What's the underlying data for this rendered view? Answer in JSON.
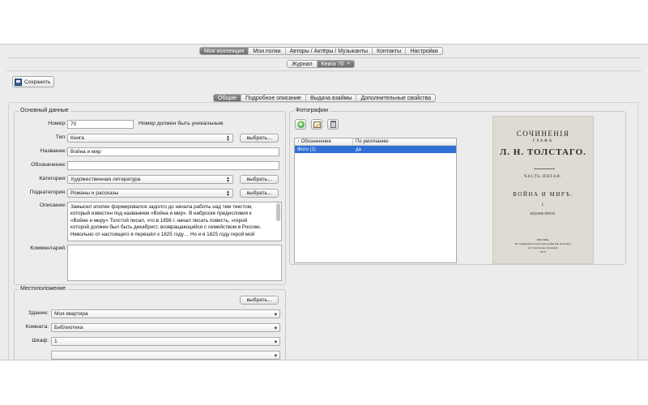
{
  "main_tabs": [
    "Моя коллекция",
    "Мои полки",
    "Авторы / Актёры / Музыканты",
    "Контакты",
    "Настройки"
  ],
  "sub_tabs": [
    {
      "label": "Журнал",
      "closable": false
    },
    {
      "label": "Книга 70",
      "closable": true
    }
  ],
  "close_glyph": "×",
  "toolbar": {
    "save_label": "Сохранить"
  },
  "inner_tabs": [
    "Общие",
    "Подробное описание",
    "Выдача взаймы",
    "Дополнительные свойства"
  ],
  "active_inner_tab": 0,
  "basic": {
    "title": "Основный данные",
    "number_label": "Номер:",
    "number_value": "70",
    "number_hint": "Номер должен быть уникальным.",
    "type_label": "Тип:",
    "type_value": "Книга",
    "name_label": "Название:",
    "name_value": "Война и мир",
    "designation_label": "Обозначение:",
    "designation_value": "",
    "category_label": "Категория:",
    "category_value": "Художественная литература",
    "subcategory_label": "Подкатегория:",
    "subcategory_value": "Романы и рассказы",
    "description_label": "Описание:",
    "description_lines": [
      "Замысел эпопеи формировался задолго до начала работы над тем текстом,",
      "который известен под названием «Война и мир». В наброске предисловия к",
      "«Войне и миру» Толстой писал, что в 1856 г. начал писать повесть, «герой",
      "которой должен был быть декабрист, возвращающийся с семейством в Россию.",
      "Невольно от настоящего я перешёл к 1825 году… Но и в 1825 году герой мой"
    ],
    "comment_label": "Комментарий:",
    "comment_value": "",
    "choose_label": "выбрать..."
  },
  "location": {
    "title": "Местоположение",
    "choose_label": "выбрать...",
    "building_label": "Здание:",
    "building_value": "Моя квартира",
    "room_label": "Комната:",
    "room_value": "Библиотека",
    "cabinet_label": "Шкаф:",
    "cabinet_value": "1"
  },
  "photos": {
    "title": "Фотографии",
    "toolbar_icons": [
      "add-photo-icon",
      "edit-photo-icon",
      "trash-icon"
    ],
    "columns": [
      "↑ Обозначение",
      "По умолчанию"
    ],
    "rows": [
      {
        "name": "Фото (1)",
        "default": "да"
      }
    ]
  },
  "book_cover": {
    "line1": "СОЧИНЕНІЯ",
    "line2": "ГРАФА",
    "line3": "Л. Н. ТОЛСТАГО.",
    "line4": "ЧАСТЬ ПЯТАЯ.",
    "line5": "ВОЙНА И МИРЪ.",
    "line6": "I.",
    "line7": "ИЗДАНІЕ ПЯТОЕ.",
    "publisher": [
      "МОСКВА.",
      "Въ Университетской типографіи (М. Катковъ),",
      "на Страстномъ бульварѣ.",
      "1873."
    ]
  },
  "colors": {
    "selection": "#2f6fd6",
    "active_tab": "#7a7a7a",
    "panel": "#ececec"
  }
}
